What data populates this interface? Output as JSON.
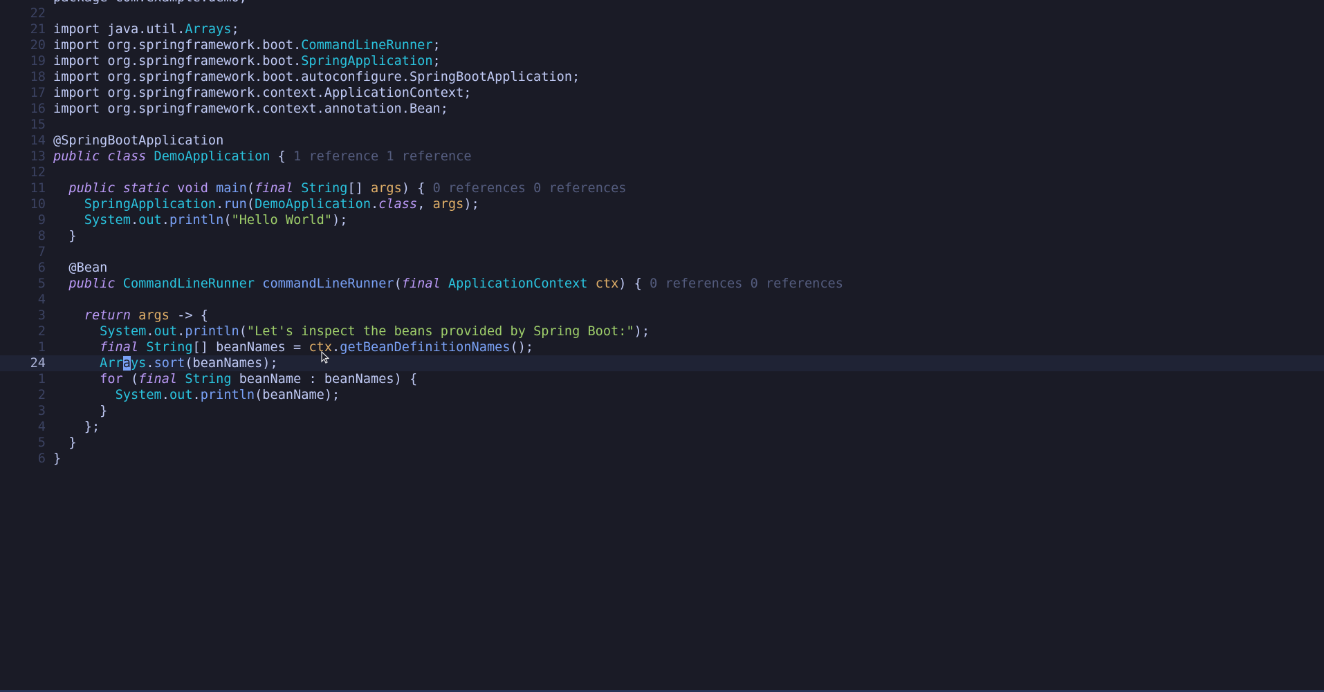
{
  "editor": {
    "lines": [
      {
        "num": "",
        "tokens": [
          {
            "t": "package com.example.demo;",
            "c": "t-plain"
          }
        ]
      },
      {
        "num": "22",
        "tokens": []
      },
      {
        "num": "21",
        "tokens": [
          {
            "t": "import java.util.",
            "c": "t-plain"
          },
          {
            "t": "Arrays",
            "c": "t-type"
          },
          {
            "t": ";",
            "c": "t-plain"
          }
        ]
      },
      {
        "num": "20",
        "tokens": [
          {
            "t": "import org.springframework.boot.",
            "c": "t-plain"
          },
          {
            "t": "CommandLineRunner",
            "c": "t-type"
          },
          {
            "t": ";",
            "c": "t-plain"
          }
        ]
      },
      {
        "num": "19",
        "tokens": [
          {
            "t": "import org.springframework.boot.",
            "c": "t-plain"
          },
          {
            "t": "SpringApplication",
            "c": "t-type"
          },
          {
            "t": ";",
            "c": "t-plain"
          }
        ]
      },
      {
        "num": "18",
        "tokens": [
          {
            "t": "import org.springframework.boot.autoconfigure.SpringBootApplication;",
            "c": "t-plain"
          }
        ]
      },
      {
        "num": "17",
        "tokens": [
          {
            "t": "import org.springframework.context.ApplicationContext;",
            "c": "t-plain"
          }
        ]
      },
      {
        "num": "16",
        "tokens": [
          {
            "t": "import org.springframework.context.annotation.Bean;",
            "c": "t-plain"
          }
        ]
      },
      {
        "num": "15",
        "tokens": []
      },
      {
        "num": "14",
        "tokens": [
          {
            "t": "@SpringBootApplication",
            "c": "t-ann"
          }
        ]
      },
      {
        "num": "13",
        "tokens": [
          {
            "t": "public class",
            "c": "t-kw"
          },
          {
            "t": " ",
            "c": "t-plain"
          },
          {
            "t": "DemoApplication",
            "c": "t-type"
          },
          {
            "t": " { ",
            "c": "t-plain"
          },
          {
            "t": "1 reference 1 reference",
            "c": "t-hint"
          }
        ]
      },
      {
        "num": "12",
        "tokens": []
      },
      {
        "num": "11",
        "tokens": [
          {
            "t": "  ",
            "c": "t-plain"
          },
          {
            "t": "public static",
            "c": "t-kw"
          },
          {
            "t": " ",
            "c": "t-plain"
          },
          {
            "t": "void",
            "c": "t-kw2"
          },
          {
            "t": " ",
            "c": "t-plain"
          },
          {
            "t": "main",
            "c": "t-fn"
          },
          {
            "t": "(",
            "c": "t-plain"
          },
          {
            "t": "final",
            "c": "t-kw"
          },
          {
            "t": " ",
            "c": "t-plain"
          },
          {
            "t": "String",
            "c": "t-type"
          },
          {
            "t": "[] ",
            "c": "t-plain"
          },
          {
            "t": "args",
            "c": "t-param"
          },
          {
            "t": ") { ",
            "c": "t-plain"
          },
          {
            "t": "0 references 0 references",
            "c": "t-hint"
          }
        ]
      },
      {
        "num": "10",
        "tokens": [
          {
            "t": "    ",
            "c": "t-plain"
          },
          {
            "t": "SpringApplication",
            "c": "t-type"
          },
          {
            "t": ".",
            "c": "t-plain"
          },
          {
            "t": "run",
            "c": "t-fn"
          },
          {
            "t": "(",
            "c": "t-plain"
          },
          {
            "t": "DemoApplication",
            "c": "t-type"
          },
          {
            "t": ".",
            "c": "t-plain"
          },
          {
            "t": "class",
            "c": "t-kw"
          },
          {
            "t": ", ",
            "c": "t-plain"
          },
          {
            "t": "args",
            "c": "t-param"
          },
          {
            "t": ");",
            "c": "t-plain"
          }
        ]
      },
      {
        "num": "9",
        "tokens": [
          {
            "t": "    ",
            "c": "t-plain"
          },
          {
            "t": "System",
            "c": "t-type"
          },
          {
            "t": ".",
            "c": "t-plain"
          },
          {
            "t": "out",
            "c": "t-type"
          },
          {
            "t": ".",
            "c": "t-plain"
          },
          {
            "t": "println",
            "c": "t-fn"
          },
          {
            "t": "(",
            "c": "t-plain"
          },
          {
            "t": "\"Hello World\"",
            "c": "t-str"
          },
          {
            "t": ");",
            "c": "t-plain"
          }
        ]
      },
      {
        "num": "8",
        "tokens": [
          {
            "t": "  }",
            "c": "t-plain"
          }
        ]
      },
      {
        "num": "7",
        "tokens": []
      },
      {
        "num": "6",
        "tokens": [
          {
            "t": "  @Bean",
            "c": "t-ann"
          }
        ]
      },
      {
        "num": "5",
        "tokens": [
          {
            "t": "  ",
            "c": "t-plain"
          },
          {
            "t": "public",
            "c": "t-kw"
          },
          {
            "t": " ",
            "c": "t-plain"
          },
          {
            "t": "CommandLineRunner",
            "c": "t-type"
          },
          {
            "t": " ",
            "c": "t-plain"
          },
          {
            "t": "commandLineRunner",
            "c": "t-fn"
          },
          {
            "t": "(",
            "c": "t-plain"
          },
          {
            "t": "final",
            "c": "t-kw"
          },
          {
            "t": " ",
            "c": "t-plain"
          },
          {
            "t": "ApplicationContext",
            "c": "t-type"
          },
          {
            "t": " ",
            "c": "t-plain"
          },
          {
            "t": "ctx",
            "c": "t-param"
          },
          {
            "t": ") { ",
            "c": "t-plain"
          },
          {
            "t": "0 references 0 references",
            "c": "t-hint"
          }
        ]
      },
      {
        "num": "4",
        "tokens": []
      },
      {
        "num": "3",
        "tokens": [
          {
            "t": "    ",
            "c": "t-plain"
          },
          {
            "t": "return",
            "c": "t-kw"
          },
          {
            "t": " ",
            "c": "t-plain"
          },
          {
            "t": "args",
            "c": "t-param"
          },
          {
            "t": " -> {",
            "c": "t-plain"
          }
        ]
      },
      {
        "num": "2",
        "tokens": [
          {
            "t": "      ",
            "c": "t-plain"
          },
          {
            "t": "System",
            "c": "t-type"
          },
          {
            "t": ".",
            "c": "t-plain"
          },
          {
            "t": "out",
            "c": "t-type"
          },
          {
            "t": ".",
            "c": "t-plain"
          },
          {
            "t": "println",
            "c": "t-fn"
          },
          {
            "t": "(",
            "c": "t-plain"
          },
          {
            "t": "\"Let's inspect the beans provided by Spring Boot:\"",
            "c": "t-str"
          },
          {
            "t": ");",
            "c": "t-plain"
          }
        ]
      },
      {
        "num": "1",
        "tokens": [
          {
            "t": "      ",
            "c": "t-plain"
          },
          {
            "t": "final",
            "c": "t-kw"
          },
          {
            "t": " ",
            "c": "t-plain"
          },
          {
            "t": "String",
            "c": "t-type"
          },
          {
            "t": "[] beanNames = ",
            "c": "t-plain"
          },
          {
            "t": "ctx",
            "c": "t-param"
          },
          {
            "t": ".",
            "c": "t-plain"
          },
          {
            "t": "getBeanDefinitionNames",
            "c": "t-fn"
          },
          {
            "t": "();",
            "c": "t-plain"
          }
        ]
      },
      {
        "num": "24",
        "current": true,
        "tokens": [
          {
            "t": "      ",
            "c": "t-plain"
          },
          {
            "t": "Arr",
            "c": "t-type"
          },
          {
            "t": "a",
            "c": "t-cursor"
          },
          {
            "t": "ys",
            "c": "t-type"
          },
          {
            "t": ".",
            "c": "t-plain"
          },
          {
            "t": "sort",
            "c": "t-fn"
          },
          {
            "t": "(beanNames);",
            "c": "t-plain"
          }
        ]
      },
      {
        "num": "1",
        "tokens": [
          {
            "t": "      ",
            "c": "t-plain"
          },
          {
            "t": "for",
            "c": "t-kw2"
          },
          {
            "t": " (",
            "c": "t-plain"
          },
          {
            "t": "final",
            "c": "t-kw"
          },
          {
            "t": " ",
            "c": "t-plain"
          },
          {
            "t": "String",
            "c": "t-type"
          },
          {
            "t": " beanName : beanNames) {",
            "c": "t-plain"
          }
        ]
      },
      {
        "num": "2",
        "tokens": [
          {
            "t": "        ",
            "c": "t-plain"
          },
          {
            "t": "System",
            "c": "t-type"
          },
          {
            "t": ".",
            "c": "t-plain"
          },
          {
            "t": "out",
            "c": "t-type"
          },
          {
            "t": ".",
            "c": "t-plain"
          },
          {
            "t": "println",
            "c": "t-fn"
          },
          {
            "t": "(beanName);",
            "c": "t-plain"
          }
        ]
      },
      {
        "num": "3",
        "tokens": [
          {
            "t": "      }",
            "c": "t-plain"
          }
        ]
      },
      {
        "num": "4",
        "tokens": [
          {
            "t": "    };",
            "c": "t-plain"
          }
        ]
      },
      {
        "num": "5",
        "tokens": [
          {
            "t": "  }",
            "c": "t-plain"
          }
        ]
      },
      {
        "num": "6",
        "tokens": [
          {
            "t": "}",
            "c": "t-plain"
          }
        ]
      }
    ]
  },
  "colors": {
    "background": "#1a1b26",
    "current_line": "#1f2335",
    "keyword": "#bb9af7",
    "type": "#2ac3de",
    "function": "#7aa2f7",
    "string": "#9ece6a",
    "parameter": "#e0af68",
    "hint": "#545c7e"
  },
  "icons": {
    "mouse_pointer": "mouse-pointer-icon"
  }
}
